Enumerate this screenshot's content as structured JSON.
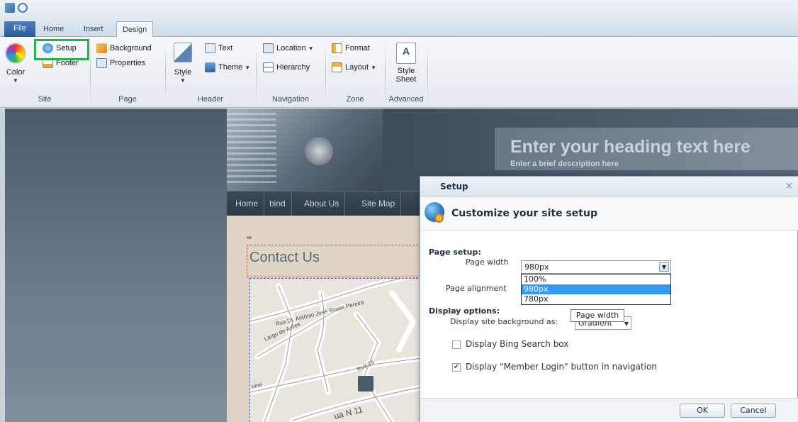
{
  "tabs": {
    "file": "File",
    "home": "Home",
    "insert": "Insert",
    "design": "Design"
  },
  "ribbon": {
    "site": {
      "label": "Site",
      "color": "Color",
      "setup": "Setup",
      "footer": "Footer"
    },
    "page": {
      "label": "Page",
      "background": "Background",
      "properties": "Properties"
    },
    "header": {
      "label": "Header",
      "style": "Style",
      "text": "Text",
      "theme": "Theme"
    },
    "navigation": {
      "label": "Navigation",
      "location": "Location",
      "hierarchy": "Hierarchy"
    },
    "zone": {
      "label": "Zone",
      "format": "Format",
      "layout": "Layout"
    },
    "advanced": {
      "label": "Advanced",
      "style_sheet_line1": "Style",
      "style_sheet_line2": "Sheet"
    }
  },
  "site_preview": {
    "heading": "Enter your heading text here",
    "subheading": "Enter a brief description here",
    "nav": [
      "Home",
      "bind",
      "About Us",
      "Site Map"
    ],
    "contact_title": "Contact Us",
    "streets": [
      "Rua Dr. Antônio José Sousa Pereira",
      "Largo de Arões",
      "Rua 15",
      "uiné",
      "ua N 11"
    ]
  },
  "dialog": {
    "title": "Setup",
    "close": "×",
    "header": "Customize your site setup",
    "page_setup_label": "Page setup:",
    "page_width_label": "Page width",
    "page_width_value": "980px",
    "page_width_options": [
      "100%",
      "980px",
      "780px"
    ],
    "page_alignment_label": "Page alignment",
    "display_options_label": "Display options:",
    "display_bg_label": "Display site background as:",
    "display_bg_value": "Gradient",
    "tooltip": "Page width",
    "bing_label": "Display Bing Search box",
    "bing_checked": false,
    "member_label": "Display \"Member Login\" button in navigation",
    "member_checked": true,
    "ok": "OK",
    "cancel": "Cancel"
  },
  "colors": {
    "highlight": "#27b34a",
    "selected_option": "#3399ff"
  }
}
